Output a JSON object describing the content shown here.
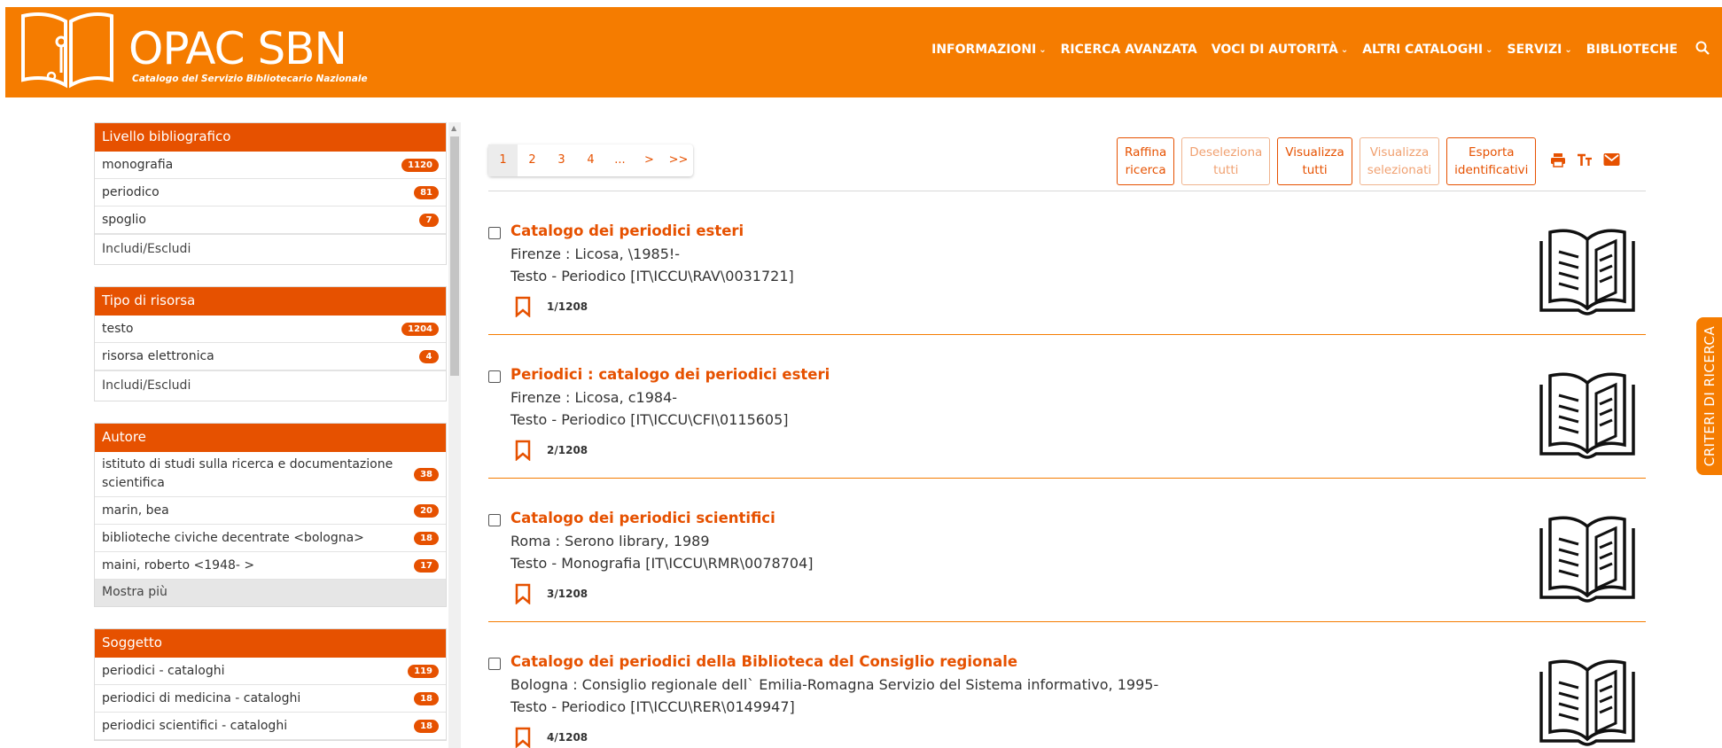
{
  "brand": {
    "title": "OPAC SBN",
    "subtitle": "Catalogo del Servizio Bibliotecario Nazionale"
  },
  "nav": {
    "items": [
      {
        "label": "INFORMAZIONI",
        "dropdown": true
      },
      {
        "label": "RICERCA AVANZATA",
        "dropdown": false
      },
      {
        "label": "VOCI DI AUTORITÀ",
        "dropdown": true
      },
      {
        "label": "ALTRI CATALOGHI",
        "dropdown": true
      },
      {
        "label": "SERVIZI",
        "dropdown": true
      },
      {
        "label": "BIBLIOTECHE",
        "dropdown": false
      }
    ],
    "search_icon": "search-icon"
  },
  "facets": [
    {
      "title": "Livello bibliografico",
      "items": [
        {
          "label": "monografia",
          "count": "1120"
        },
        {
          "label": "periodico",
          "count": "81"
        },
        {
          "label": "spoglio",
          "count": "7"
        }
      ],
      "footer": "Includi/Escludi"
    },
    {
      "title": "Tipo di risorsa",
      "items": [
        {
          "label": "testo",
          "count": "1204"
        },
        {
          "label": "risorsa elettronica",
          "count": "4"
        }
      ],
      "footer": "Includi/Escludi"
    },
    {
      "title": "Autore",
      "items": [
        {
          "label": "istituto di studi sulla ricerca e documentazione scientifica",
          "count": "38"
        },
        {
          "label": "marin, bea",
          "count": "20"
        },
        {
          "label": "biblioteche civiche decentrate <bologna>",
          "count": "18"
        },
        {
          "label": "maini, roberto <1948- >",
          "count": "17"
        }
      ],
      "more": "Mostra più"
    },
    {
      "title": "Soggetto",
      "items": [
        {
          "label": "periodici - cataloghi",
          "count": "119"
        },
        {
          "label": "periodici di medicina - cataloghi",
          "count": "18"
        },
        {
          "label": "periodici scientifici - cataloghi",
          "count": "18"
        }
      ]
    }
  ],
  "pagination": {
    "pages": [
      "1",
      "2",
      "3",
      "4",
      "...",
      ">",
      ">>"
    ],
    "active": "1"
  },
  "toolbar": {
    "refine": [
      "Raffina",
      "ricerca"
    ],
    "deselect": [
      "Deseleziona",
      "tutti"
    ],
    "show_all": [
      "Visualizza",
      "tutti"
    ],
    "show_selected": [
      "Visualizza",
      "selezionati"
    ],
    "export": [
      "Esporta",
      "identificativi"
    ],
    "icons": [
      "print-icon",
      "font-size-icon",
      "email-icon"
    ]
  },
  "results": [
    {
      "title": "Catalogo dei periodici esteri",
      "publication": "Firenze : Licosa, \\1985!-",
      "type": "Testo - Periodico [IT\\ICCU\\RAV\\0031721]",
      "position": "1",
      "total": "/1208"
    },
    {
      "title": "Periodici : catalogo dei periodici esteri",
      "publication": "Firenze : Licosa, c1984-",
      "type": "Testo - Periodico [IT\\ICCU\\CFI\\0115605]",
      "position": "2",
      "total": "/1208"
    },
    {
      "title": "Catalogo dei periodici scientifici",
      "publication": "Roma : Serono library, 1989",
      "type": "Testo - Monografia [IT\\ICCU\\RMR\\0078704]",
      "position": "3",
      "total": "/1208"
    },
    {
      "title": "Catalogo dei periodici della Biblioteca del Consiglio regionale",
      "publication": "Bologna : Consiglio regionale dell` Emilia-Romagna Servizio del Sistema informativo, 1995-",
      "type": "Testo - Periodico [IT\\ICCU\\RER\\0149947]",
      "position": "4",
      "total": "/1208"
    }
  ],
  "side_tab": "CRITERI DI RICERCA",
  "colors": {
    "header": "#f57c00",
    "accent": "#e65100"
  }
}
